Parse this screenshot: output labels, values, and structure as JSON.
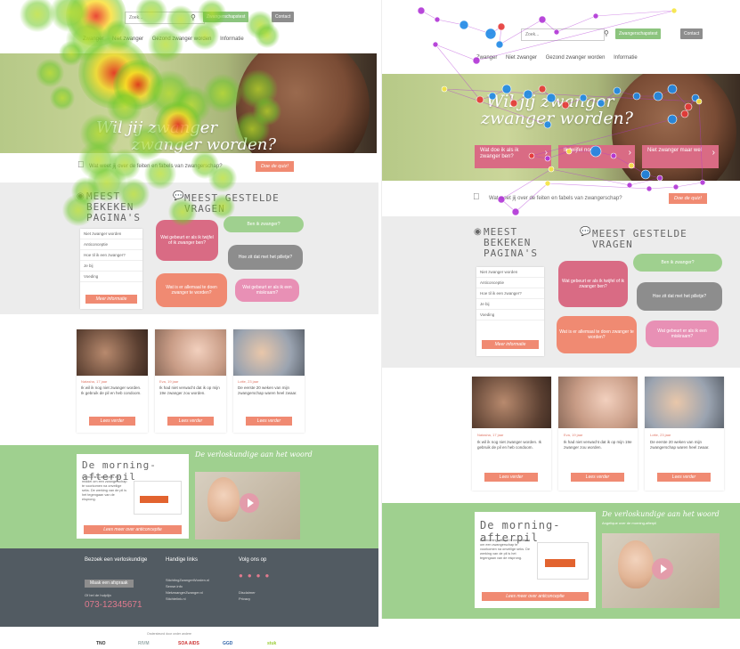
{
  "site": {
    "search_placeholder": "Zoek...",
    "btn_pregnancy_test": "Zwangerschapstest",
    "btn_contact": "Contact",
    "menu": [
      "Zwanger",
      "Niet zwanger",
      "Gezond zwanger worden",
      "Informatie"
    ],
    "hero_title_line1": "Wil jij zwanger",
    "hero_title_line2": "zwanger worden?",
    "hero_buttons": [
      "Wat doe ik als ik zwanger ben?",
      "Ik twijfel nog...",
      "Niet zwanger maar wel"
    ],
    "quiz_text": "Wat weet jij over de feiten en fabels van zwangerschap?",
    "quiz_button": "Doe de quiz!",
    "most_visited_title": "Meest bekeken pagina's",
    "faq_title": "Meest gestelde vragen",
    "list_items": [
      "Niet zwanger worden",
      "Anticonceptie",
      "Hoe til ik een zwanger?",
      "Je bij",
      "Voeding"
    ],
    "more_info_button": "Meer informatie",
    "faq_bubbles": [
      "Wat gebeurt er als ik twijfel of ik zwanger ben?",
      "Ben ik zwanger?",
      "Hoe zit dat met het pilletje?",
      "Wat is er allemaal te doen zwanger te worden?",
      "Wat gebeurt er als ik een miskraam?"
    ],
    "stories": [
      {
        "name": "Natasha, 17 jaar",
        "text": "Ik wil ik nog niet zwanger worden. Ik gebruik de pil en heb condoom.",
        "button": "Lees verder"
      },
      {
        "name": "Eva, 19 jaar",
        "text": "Ik had niet verwacht dat ik op mijn 19e zwanger zou worden.",
        "button": "Lees verder"
      },
      {
        "name": "Lotte, 23 jaar",
        "text": "De eerste 20 weken van mijn zwangerschap waren heel zwaar.",
        "button": "Lees verder"
      }
    ],
    "morning_title": "De morning-afterpil",
    "morning_text": "De morning-afterpil is een middel om een zwangerschap te voorkomen na onveilige seks. De werking van de pil is het tegengaan van de eisprong.",
    "morning_button": "Lees meer over anticonceptie",
    "video_title": "De verloskundige aan het woord",
    "video_subtitle": "Angelique over de morning-afterpil",
    "footer": {
      "visit_title": "Bezoek een verloskundige",
      "visit_button": "Maak een afspraak",
      "phone_label": "Of bel de hulplijn",
      "phone": "073-12345671",
      "links_title": "Handige links",
      "links": [
        "StichtingZwangerWorden.nl",
        "Sense.info",
        "NietzwangerZwanger.nl",
        "Stichtelink.nl"
      ],
      "follow_title": "Volg ons op",
      "follow_links": [
        "Disclaimer",
        "Privacy"
      ]
    },
    "partners_caption": "Ondersteund door onder andere",
    "partners": [
      "TNO",
      "RIVM",
      "SOA AIDS",
      "GGD",
      "stuk"
    ]
  },
  "colors": {
    "pink": "#d96b84",
    "orange": "#f08a72",
    "green": "#9fd08f",
    "grey_band": "#ececec",
    "footer": "#525b62",
    "blue_dot": "#1e88e5",
    "red_dot": "#e53935",
    "purple_dot": "#b034d6",
    "yellow_dot": "#f5e642"
  }
}
